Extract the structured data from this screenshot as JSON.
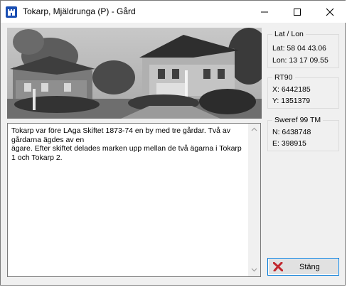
{
  "window": {
    "title": "Tokarp, Mjäldrunga (P) - Gård",
    "app_icon": "castle-icon",
    "controls": [
      "minimize-icon",
      "maximize-icon",
      "close-icon"
    ]
  },
  "description": "Tokarp var före LAga Skiftet 1873-74 en by med tre gårdar. Två av gårdarna ägdes av en\nägare. Efter skiftet delades marken upp mellan de två ägarna i Tokarp 1 och Tokarp 2.",
  "coordinates": {
    "latlon": {
      "title": "Lat / Lon",
      "lat": "Lat: 58 04 43.06",
      "lon": "Lon: 13 17 09.55"
    },
    "rt90": {
      "title": "RT90",
      "x": "X: 6442185",
      "y": "Y: 1351379"
    },
    "sweref": {
      "title": "Sweref 99 TM",
      "n": "N: 6438748",
      "e": "E: 398915"
    }
  },
  "buttons": {
    "close_label": "Stäng",
    "close_icon": "red-x-icon"
  },
  "colors": {
    "accent_border": "#0078d7",
    "close_x": "#c1272d",
    "app_icon_bg": "#1b4fb3"
  }
}
